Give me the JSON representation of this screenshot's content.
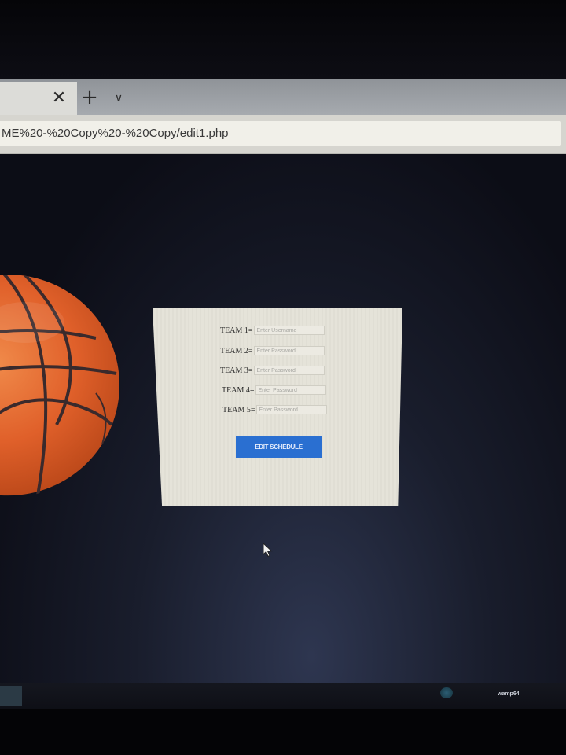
{
  "browser": {
    "tab_close_glyph": "✕",
    "new_tab_glyph": "+",
    "tab_list_glyph": "∨",
    "url": "ME%20-%20Copy%20-%20Copy/edit1.php"
  },
  "form": {
    "teams": [
      {
        "label": "TEAM 1=",
        "placeholder": "Enter Username"
      },
      {
        "label": "TEAM 2=",
        "placeholder": "Enter Password"
      },
      {
        "label": "TEAM 3=",
        "placeholder": "Enter Password"
      },
      {
        "label": "TEAM 4=",
        "placeholder": "Enter Password"
      },
      {
        "label": "TEAM 5=",
        "placeholder": "Enter Password"
      }
    ],
    "submit_label": "EDIT SCHEDULE"
  },
  "taskbar": {
    "tray_label": "wamp64"
  },
  "colors": {
    "button": "#2a6fd1",
    "panel": "#e5e3d9",
    "page_background": "#0c0d16",
    "ball": "#e2622a"
  },
  "icons": {
    "decorative_image": "basketball",
    "pointer": "mouse-cursor-arrow"
  }
}
